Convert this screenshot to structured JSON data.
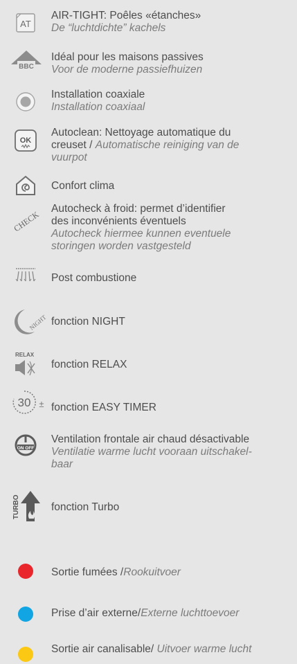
{
  "features": [
    {
      "icon": "air-tight-icon",
      "fr": "AIR-TIGHT: Poêles «étanches»",
      "nl": "De “luchtdichte” kachels"
    },
    {
      "icon": "bbc-house-icon",
      "fr": "Idéal pour les maisons passives",
      "nl": "Voor de moderne passiefhuizen"
    },
    {
      "icon": "coaxial-icon",
      "fr": "Installation coaxiale",
      "nl": "Installation coaxiaal"
    },
    {
      "icon": "autoclean-icon",
      "fr1": "Autoclean: Nettoyage automatique du",
      "fr2": "creuset / ",
      "nl1": "Automatische reiniging van de",
      "nl2": "vuurpot"
    },
    {
      "icon": "confort-clima-icon",
      "fr": "Confort clima"
    },
    {
      "icon": "check-icon",
      "fr1": "Autocheck à froid: permet d’identifier",
      "fr2": "des inconvénients éventuels",
      "nl1": "Autocheck hiermee kunnen eventuele",
      "nl2": "storingen worden vastgesteld"
    },
    {
      "icon": "post-combustion-icon",
      "fr": "Post combustione"
    },
    {
      "icon": "night-icon",
      "fr": "fonction NIGHT",
      "icon_text": "NIGHT"
    },
    {
      "icon": "relax-icon",
      "fr": "fonction RELAX",
      "icon_text": "RELAX"
    },
    {
      "icon": "easy-timer-icon",
      "fr": "fonction EASY TIMER",
      "icon_text": "30",
      "icon_sub": "±"
    },
    {
      "icon": "on-off-icon",
      "fr": "Ventilation frontale air chaud  désactivable",
      "nl1": "Ventilatie warme lucht vooraan uitschakel-",
      "nl2": "baar",
      "icon_text": "ON OFF"
    },
    {
      "icon": "turbo-icon",
      "fr": "fonction Turbo",
      "icon_text": "TURBO"
    }
  ],
  "legend": [
    {
      "color": "#e8262b",
      "fr": "Sortie fumées /",
      "nl": "Rookuitvoer"
    },
    {
      "color": "#12a5e3",
      "fr": "Prise d’air externe/",
      "nl": "Externe luchttoevoer"
    },
    {
      "color": "#fbc813",
      "fr": "Sortie air canalisable/ ",
      "nl": "Uitvoer warme lucht"
    }
  ]
}
